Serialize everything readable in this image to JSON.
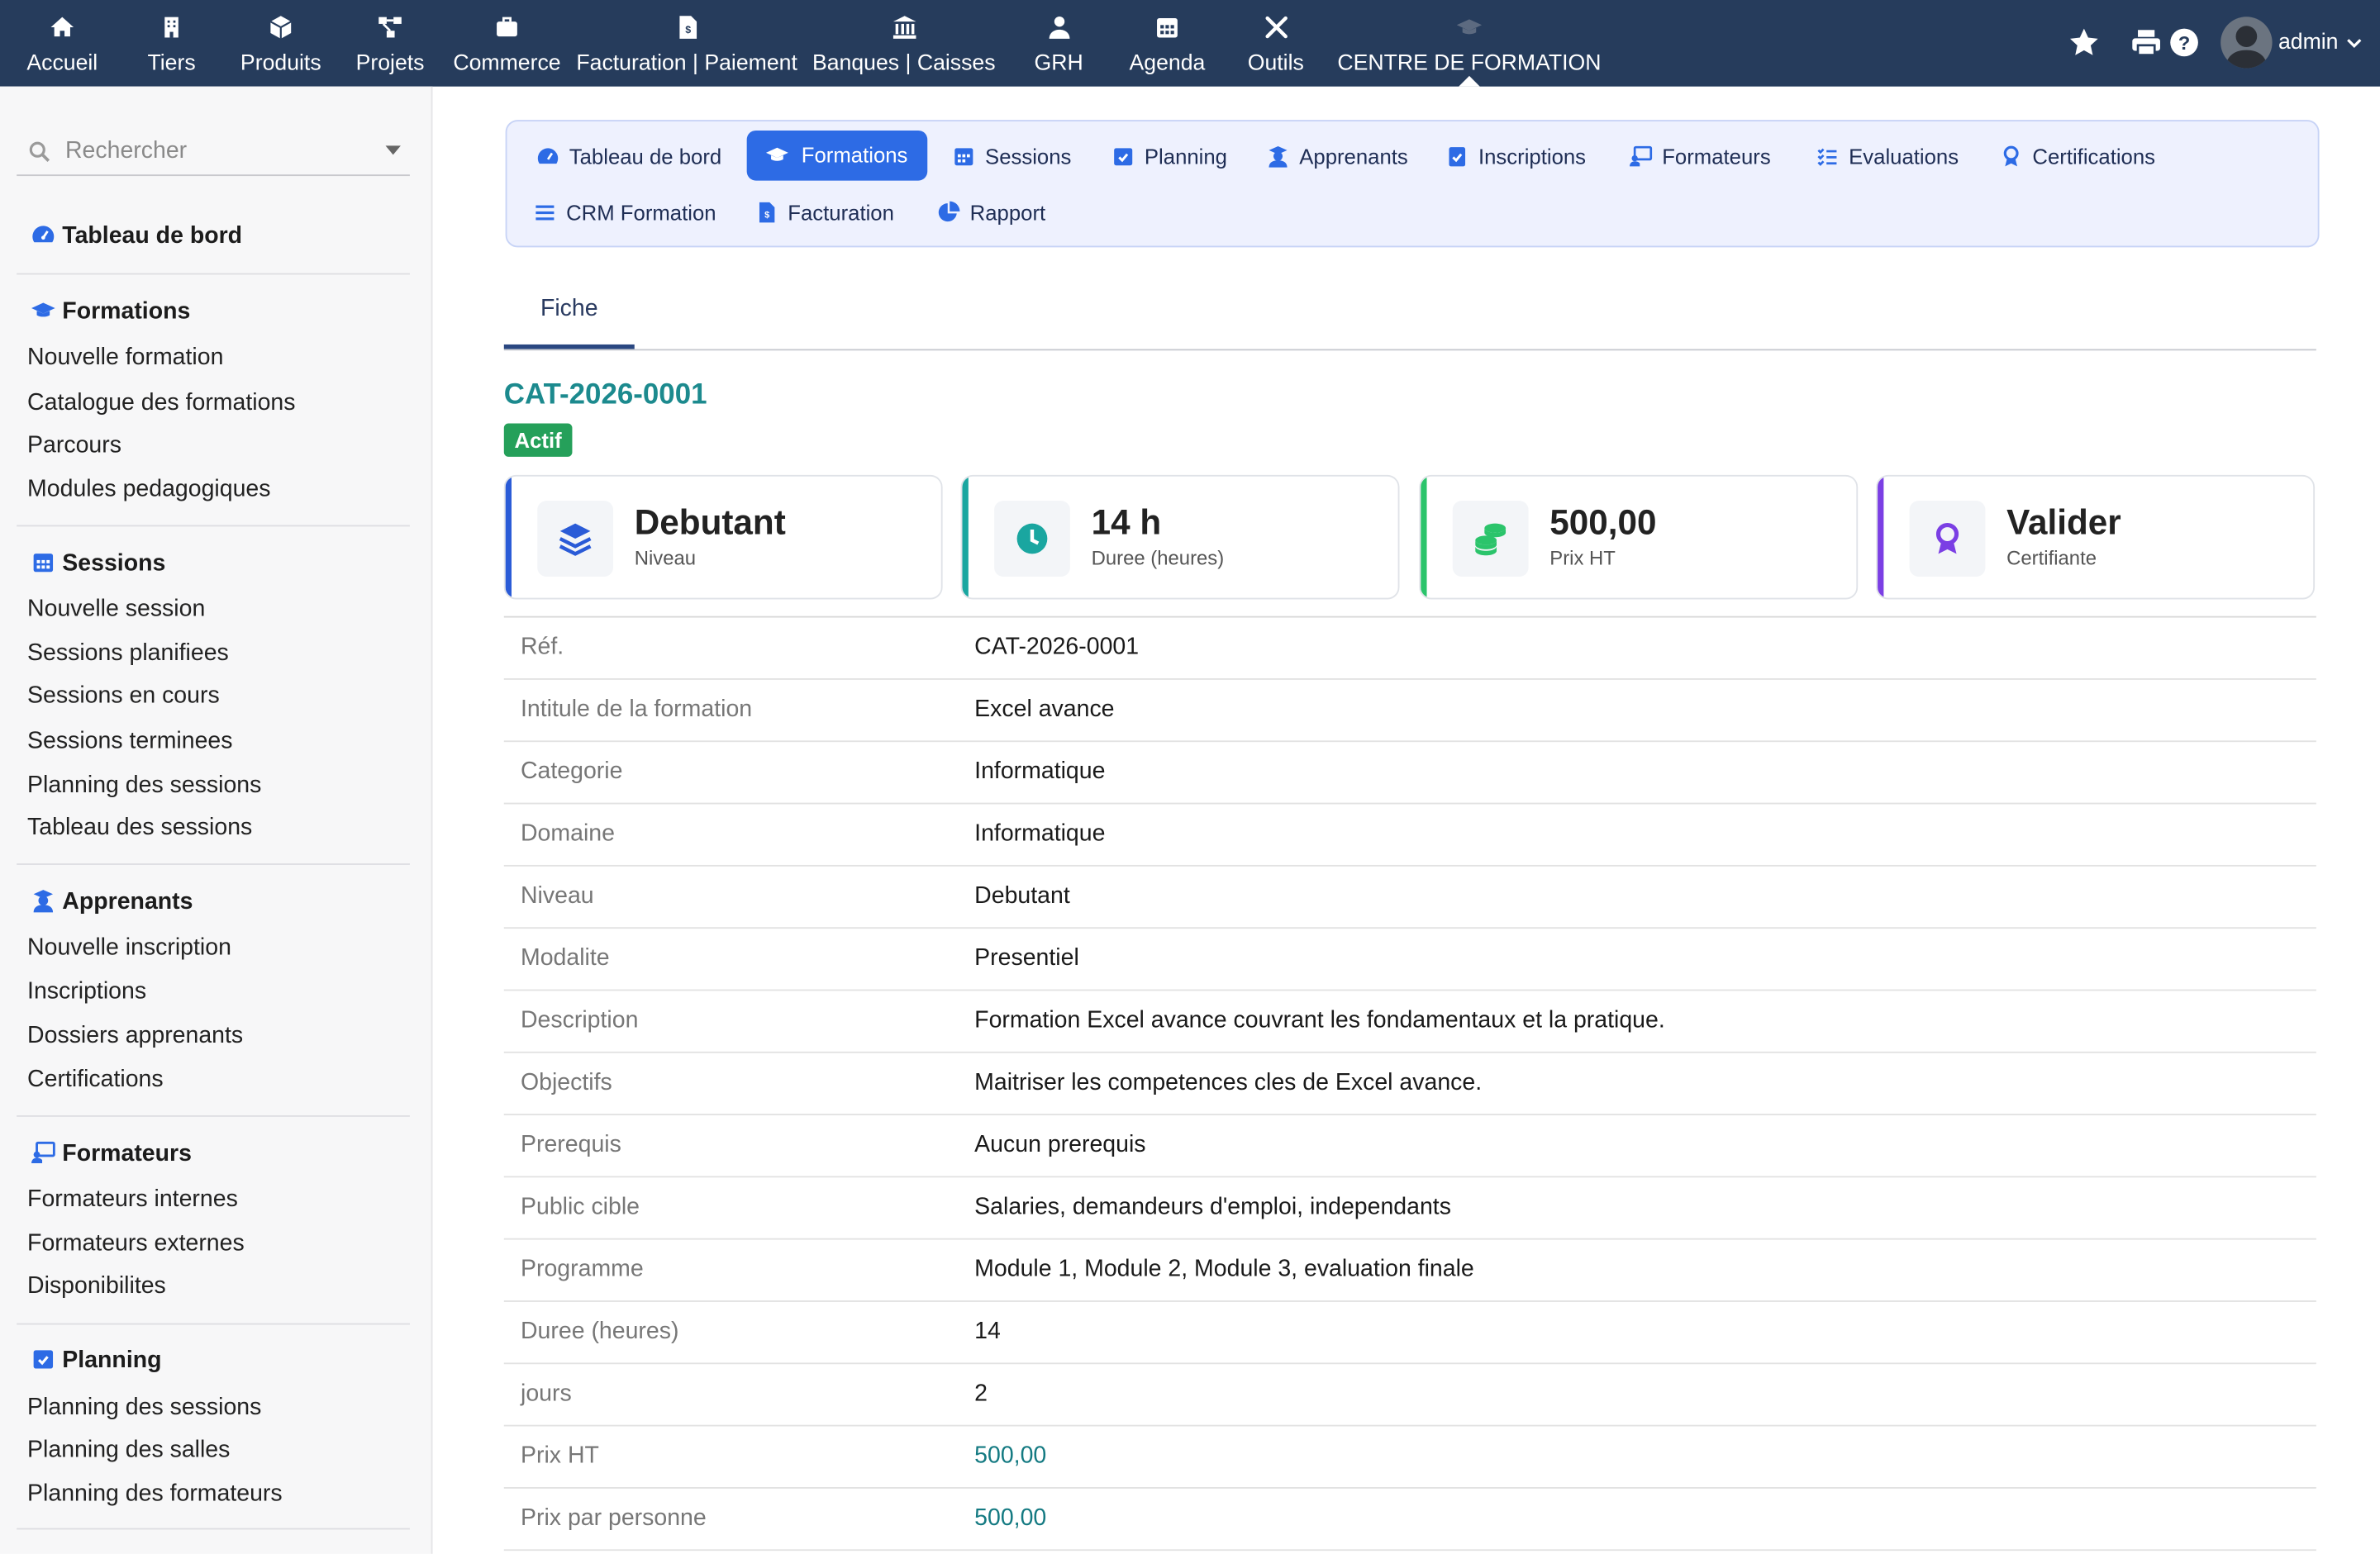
{
  "topnav": {
    "items": [
      {
        "label": "Accueil",
        "icon": "home-icon"
      },
      {
        "label": "Tiers",
        "icon": "building-icon"
      },
      {
        "label": "Produits",
        "icon": "cube-icon"
      },
      {
        "label": "Projets",
        "icon": "project-diagram-icon"
      },
      {
        "label": "Commerce",
        "icon": "briefcase-icon"
      },
      {
        "label": "Facturation | Paiement",
        "icon": "invoice-icon"
      },
      {
        "label": "Banques | Caisses",
        "icon": "bank-icon"
      },
      {
        "label": "GRH",
        "icon": "user-tie-icon"
      },
      {
        "label": "Agenda",
        "icon": "calendar-icon"
      },
      {
        "label": "Outils",
        "icon": "tools-icon"
      },
      {
        "label": "CENTRE DE FORMATION",
        "icon": "graduation-cap-icon"
      }
    ],
    "active_index": 10,
    "user": "admin"
  },
  "sidebar": {
    "search_placeholder": "Rechercher",
    "dashboard": "Tableau de bord",
    "sections": [
      {
        "title": "Formations",
        "icon": "graduation-cap-icon",
        "links": [
          "Nouvelle formation",
          "Catalogue des formations",
          "Parcours",
          "Modules pedagogiques"
        ]
      },
      {
        "title": "Sessions",
        "icon": "calendar-icon",
        "links": [
          "Nouvelle session",
          "Sessions planifiees",
          "Sessions en cours",
          "Sessions terminees",
          "Planning des sessions",
          "Tableau des sessions"
        ]
      },
      {
        "title": "Apprenants",
        "icon": "user-graduate-icon",
        "links": [
          "Nouvelle inscription",
          "Inscriptions",
          "Dossiers apprenants",
          "Certifications"
        ]
      },
      {
        "title": "Formateurs",
        "icon": "chalkboard-teacher-icon",
        "links": [
          "Formateurs internes",
          "Formateurs externes",
          "Disponibilites"
        ]
      },
      {
        "title": "Planning",
        "icon": "calendar-check-icon",
        "links": [
          "Planning des sessions",
          "Planning des salles",
          "Planning des formateurs"
        ]
      }
    ]
  },
  "subnav": {
    "items": [
      {
        "label": "Tableau de bord",
        "icon": "dashboard-icon"
      },
      {
        "label": "Formations",
        "icon": "graduation-cap-icon"
      },
      {
        "label": "Sessions",
        "icon": "calendar-icon"
      },
      {
        "label": "Planning",
        "icon": "calendar-check-icon"
      },
      {
        "label": "Apprenants",
        "icon": "user-graduate-icon"
      },
      {
        "label": "Inscriptions",
        "icon": "clipboard-check-icon"
      },
      {
        "label": "Formateurs",
        "icon": "chalkboard-teacher-icon"
      },
      {
        "label": "Evaluations",
        "icon": "list-check-icon"
      },
      {
        "label": "Certifications",
        "icon": "award-icon"
      },
      {
        "label": "CRM Formation",
        "icon": "bars-icon"
      },
      {
        "label": "Facturation",
        "icon": "invoice-icon"
      },
      {
        "label": "Rapport",
        "icon": "pie-chart-icon"
      }
    ],
    "active_index": 1
  },
  "tabs": {
    "fiche": "Fiche"
  },
  "record": {
    "ref": "CAT-2026-0001",
    "status": "Actif"
  },
  "cards": [
    {
      "value": "Debutant",
      "label": "Niveau",
      "icon": "layers-icon",
      "color": "#2a5bd7"
    },
    {
      "value": "14 h",
      "label": "Duree (heures)",
      "icon": "clock-icon",
      "color": "#1aa6a0"
    },
    {
      "value": "500,00",
      "label": "Prix HT",
      "icon": "coins-icon",
      "color": "#2bc46b"
    },
    {
      "value": "Valider",
      "label": "Certifiante",
      "icon": "award-icon",
      "color": "#7b3fe4"
    }
  ],
  "fields": [
    {
      "key": "Réf.",
      "value": "CAT-2026-0001"
    },
    {
      "key": "Intitule de la formation",
      "value": "Excel avance"
    },
    {
      "key": "Categorie",
      "value": "Informatique"
    },
    {
      "key": "Domaine",
      "value": "Informatique"
    },
    {
      "key": "Niveau",
      "value": "Debutant"
    },
    {
      "key": "Modalite",
      "value": "Presentiel"
    },
    {
      "key": "Description",
      "value": "Formation Excel avance couvrant les fondamentaux et la pratique."
    },
    {
      "key": "Objectifs",
      "value": "Maitriser les competences cles de Excel avance."
    },
    {
      "key": "Prerequis",
      "value": "Aucun prerequis"
    },
    {
      "key": "Public cible",
      "value": "Salaries, demandeurs d'emploi, independants"
    },
    {
      "key": "Programme",
      "value": "Module 1, Module 2, Module 3, evaluation finale"
    },
    {
      "key": "Duree (heures)",
      "value": "14"
    },
    {
      "key": "jours",
      "value": "2"
    },
    {
      "key": "Prix HT",
      "value": "500,00"
    },
    {
      "key": "Prix par personne",
      "value": "500,00"
    }
  ]
}
